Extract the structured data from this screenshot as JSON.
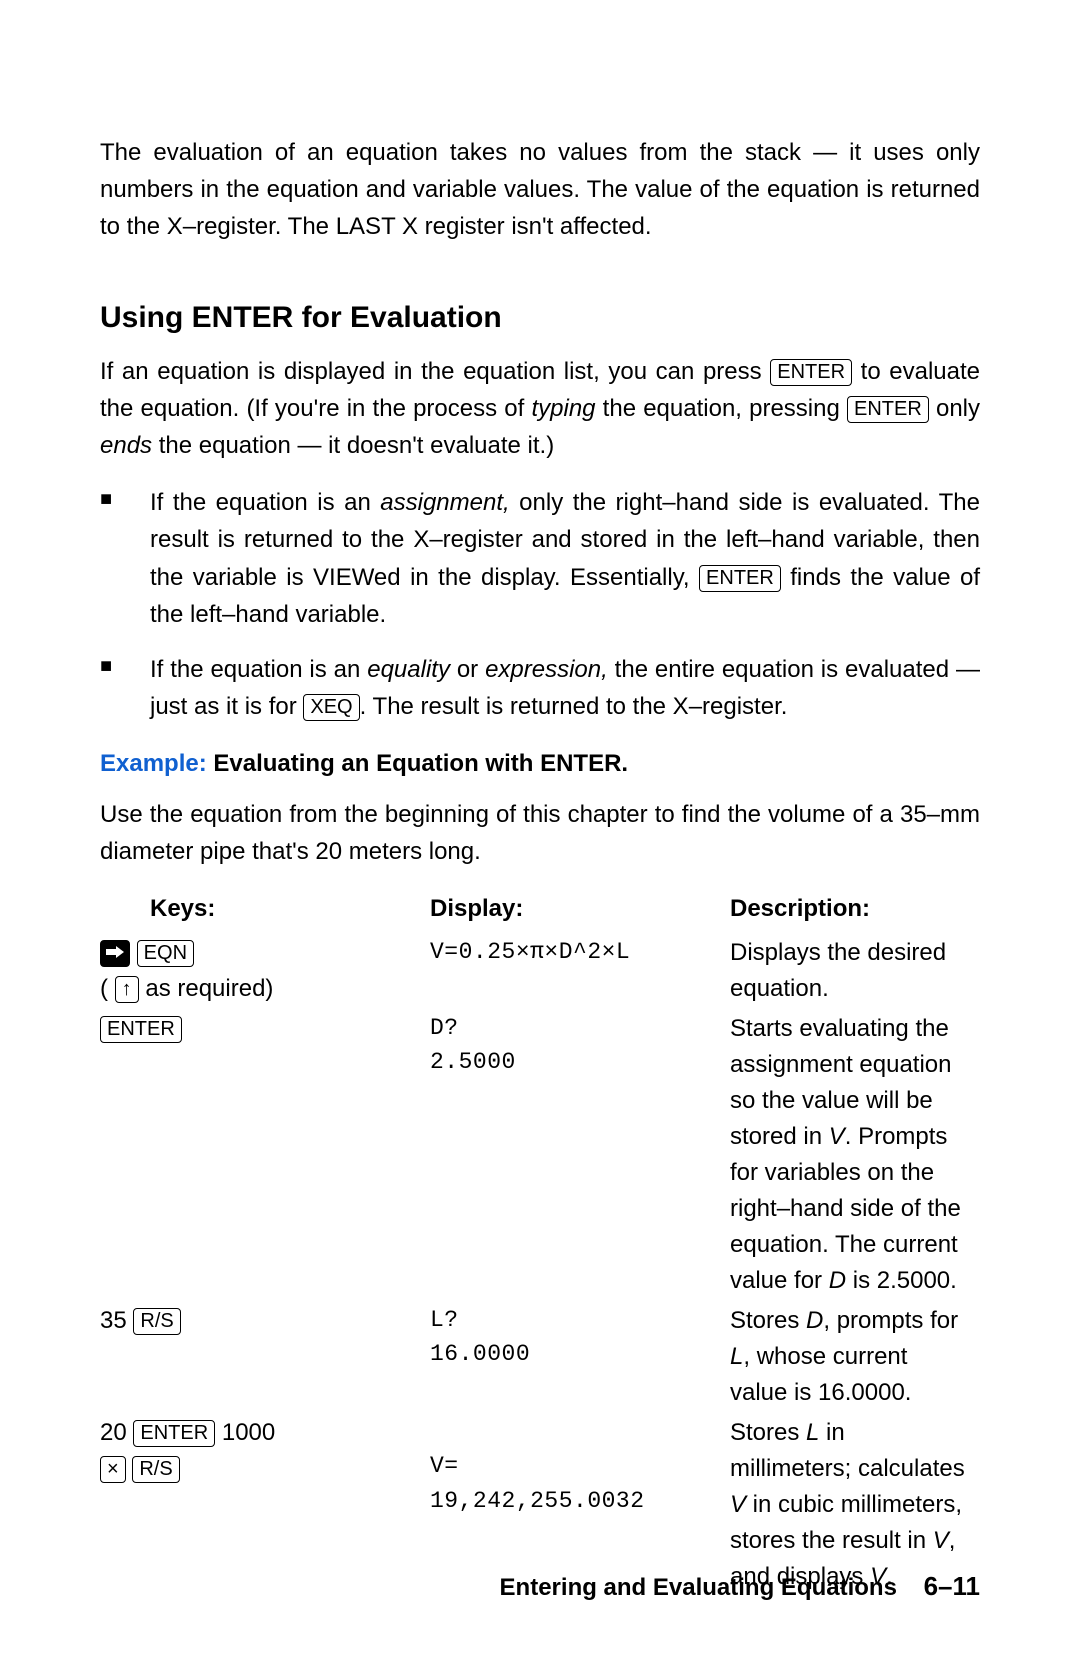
{
  "intro": "The evaluation of an equation takes no values from the stack — it uses only numbers in the equation and variable values. The value of the equation is returned to the X–register. The LAST X register isn't affected.",
  "section_heading": "Using ENTER for Evaluation",
  "para1_a": "If an equation is displayed in the equation list, you can press ",
  "key_enter": "ENTER",
  "para1_b": " to evaluate the equation. (If you're in the process of ",
  "para1_typing": "typing",
  "para1_c": " the equation, pressing ",
  "para1_d": " only ",
  "para1_ends": "ends",
  "para1_e": " the equation — it doesn't evaluate it.)",
  "bullet1_a": "If the equation is an ",
  "bullet1_assignment": "assignment,",
  "bullet1_b": " only the right–hand side is evaluated. The result is returned to the X–register and stored in the left–hand variable, then the variable is VIEWed in the display. Essentially, ",
  "bullet1_c": " finds the value of the left–hand variable.",
  "bullet2_a": "If the equation is an ",
  "bullet2_equality": "equality",
  "bullet2_or": " or ",
  "bullet2_expression": "expression,",
  "bullet2_b": " the entire equation is evaluated — just as it is for ",
  "key_xeq": "XEQ",
  "bullet2_c": ". The result is returned to the X–register.",
  "example_label": "Example:",
  "example_title": " Evaluating an Equation with ENTER.",
  "example_para": "Use the equation from the beginning of this chapter to find the volume of a 35–mm diameter pipe that's 20 meters long.",
  "th_keys": "Keys:",
  "th_display": "Display:",
  "th_desc": "Description:",
  "key_eqn": "EQN",
  "key_up": "↑",
  "key_rs": "R/S",
  "key_x": "×",
  "row1_keys_suffix": " as required)",
  "row1_display": "V=0.25×π×D^2×L",
  "row1_desc": "Displays the desired equation.",
  "row2_display_1": "D?",
  "row2_display_2": "2.5000",
  "row2_desc_a": "Starts evaluating the assignment equation so the value will be stored in ",
  "row2_desc_V": "V",
  "row2_desc_b": ". Prompts for variables on the right–hand side of the equation. The current value for ",
  "row2_desc_D": "D",
  "row2_desc_c": " is 2.5000.",
  "row3_keys_prefix": "35 ",
  "row3_display_1": "L?",
  "row3_display_2": "16.0000",
  "row3_desc_a": "Stores ",
  "row3_desc_b": ", prompts for ",
  "row3_desc_L": "L",
  "row3_desc_c": ", whose current value is 16.0000.",
  "row4_keys_prefix": "20 ",
  "row4_keys_mid": " 1000",
  "row4_display_1": "V=",
  "row4_display_2": "19,242,255.0032",
  "row4_desc_a": "Stores ",
  "row4_desc_b": " in millimeters; calculates ",
  "row4_desc_c": " in cubic millimeters, stores the result in ",
  "row4_desc_d": ", and displays ",
  "row4_desc_e": ".",
  "footer_title": "Entering and Evaluating Equations",
  "footer_page": "6–11"
}
